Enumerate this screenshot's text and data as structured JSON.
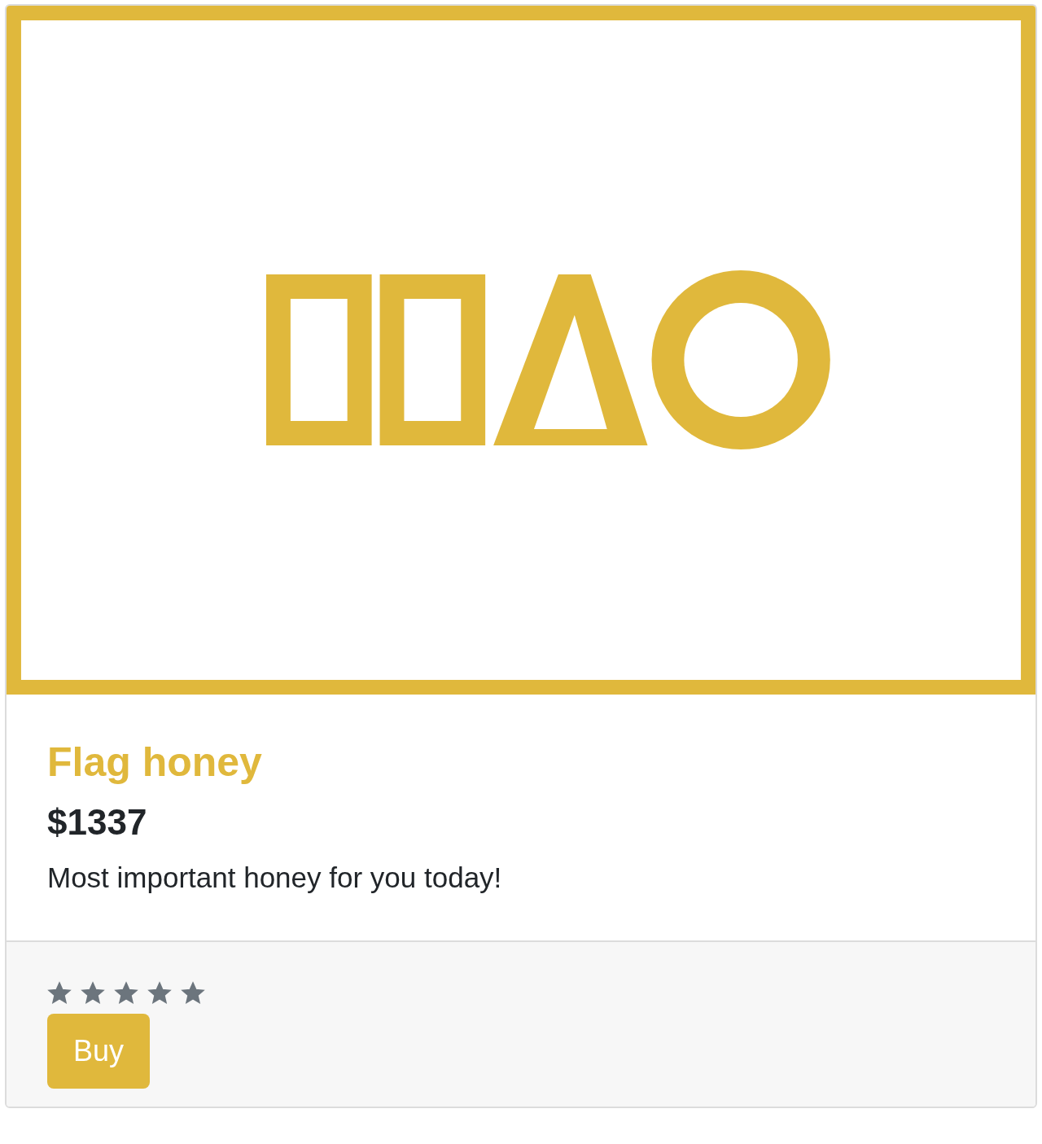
{
  "product": {
    "title": "Flag honey",
    "price": "$1337",
    "description": "Most important honey for you today!"
  },
  "footer": {
    "stars": 5,
    "buy_button": "Buy"
  }
}
